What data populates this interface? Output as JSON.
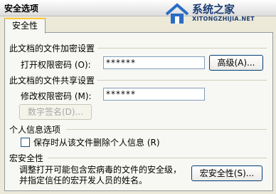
{
  "window": {
    "title": "安全选项",
    "brand_name": "系统之家",
    "brand_url": "XITONGZHIJIA.NET"
  },
  "tabs": [
    {
      "label": "安全性",
      "selected": true
    }
  ],
  "encryption": {
    "section_title": "此文档的文件加密设置",
    "open_password_label": "打开权限密码 (O):",
    "open_password_value": "******",
    "advanced_button": "高级(A)..."
  },
  "sharing": {
    "section_title": "此文档的文件共享设置",
    "modify_password_label": "修改权限密码 (M):",
    "modify_password_value": "******",
    "digital_signature_button": "数字签名(D)..."
  },
  "privacy": {
    "section_title": "个人信息选项",
    "remove_personal_info_label": "保存时从该文件删除个人信息 (R)",
    "remove_personal_info_checked": false
  },
  "macro": {
    "section_title": "宏安全性",
    "description_line1": "调整打开可能包含宏病毒的文件的安全级，",
    "description_line2": "并指定信任的宏开发人员的姓名。",
    "macro_security_button": "宏安全性(S)..."
  }
}
